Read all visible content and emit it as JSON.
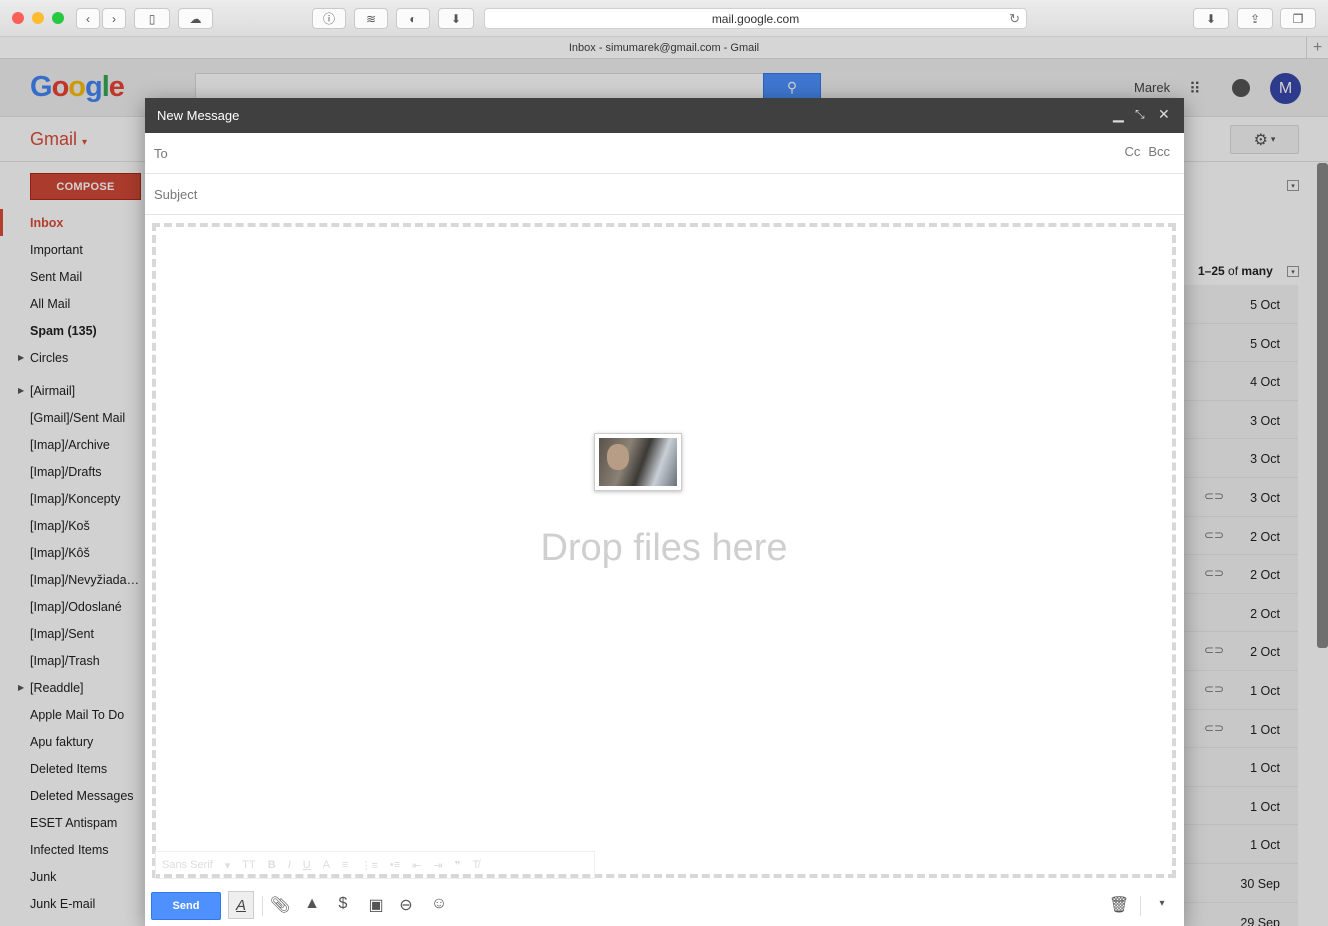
{
  "browser": {
    "url": "mail.google.com",
    "tab_title": "Inbox - simumarek@gmail.com - Gmail"
  },
  "header": {
    "logo": "Google",
    "user_name": "Marek",
    "avatar_letter": "M"
  },
  "gmail_label": "Gmail",
  "compose_button": "COMPOSE",
  "sidebar": {
    "items": [
      {
        "label": "Inbox"
      },
      {
        "label": "Important"
      },
      {
        "label": "Sent Mail"
      },
      {
        "label": "All Mail"
      },
      {
        "label": "Spam (135)"
      },
      {
        "label": "Circles"
      },
      {
        "label": "[Airmail]"
      },
      {
        "label": "[Gmail]/Sent Mail"
      },
      {
        "label": "[Imap]/Archive"
      },
      {
        "label": "[Imap]/Drafts"
      },
      {
        "label": "[Imap]/Koncepty"
      },
      {
        "label": "[Imap]/Koš"
      },
      {
        "label": "[Imap]/Kôš"
      },
      {
        "label": "[Imap]/Nevyžiadaná pošta"
      },
      {
        "label": "[Imap]/Odoslané"
      },
      {
        "label": "[Imap]/Sent"
      },
      {
        "label": "[Imap]/Trash"
      },
      {
        "label": "[Readdle]"
      },
      {
        "label": "Apple Mail To Do"
      },
      {
        "label": "Apu faktury"
      },
      {
        "label": "Deleted Items"
      },
      {
        "label": "Deleted Messages"
      },
      {
        "label": "ESET Antispam"
      },
      {
        "label": "Infected Items"
      },
      {
        "label": "Junk"
      },
      {
        "label": "Junk E-mail"
      }
    ]
  },
  "pager": {
    "range": "1–25",
    "of": "of",
    "total": "many"
  },
  "emails": [
    {
      "date": "5 Oct"
    },
    {
      "date": "5 Oct"
    },
    {
      "date": "4 Oct"
    },
    {
      "date": "3 Oct"
    },
    {
      "date": "3 Oct"
    },
    {
      "date": "3 Oct"
    },
    {
      "date": "2 Oct"
    },
    {
      "date": "2 Oct"
    },
    {
      "date": "2 Oct"
    },
    {
      "date": "2 Oct"
    },
    {
      "date": "1 Oct"
    },
    {
      "date": "1 Oct"
    },
    {
      "date": "1 Oct"
    },
    {
      "date": "1 Oct"
    },
    {
      "date": "1 Oct"
    },
    {
      "date": "30 Sep"
    },
    {
      "date": "29 Sep"
    }
  ],
  "compose": {
    "title": "New Message",
    "to_placeholder": "To",
    "cc": "Cc",
    "bcc": "Bcc",
    "subject_placeholder": "Subject",
    "drop_text": "Drop files here",
    "font_name": "Sans Serif",
    "send_label": "Send"
  }
}
